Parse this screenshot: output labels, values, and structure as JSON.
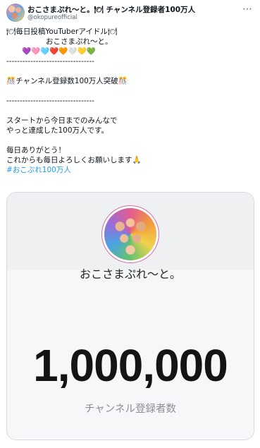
{
  "header": {
    "display_name": "おこさまぷれ〜と。🍽 チャンネル登録者100万人",
    "handle": "@okopureofficial",
    "more_icon": "⋯"
  },
  "tweet": {
    "lines": [
      "🍽毎日投稿YouTuberアイドル🍽",
      "おこさまぷれ〜と。",
      "💜🩷🩵❤️🧡🤍💛💚",
      "---------------------------------",
      "",
      "🎊チャンネル登録数100万人突破🎊",
      "",
      "---------------------------------",
      "",
      "スタートから今日までのみんなで",
      "やっと達成した100万人です。",
      "",
      "毎日ありがとう！",
      "これからも毎日よろしくお願いします🙏"
    ],
    "hashtag": "#おこぷれ100万人"
  },
  "card": {
    "channel_name": "おこさまぷれ〜と。",
    "subscriber_count": "1,000,000",
    "subscriber_label": "チャンネル登録者数"
  }
}
